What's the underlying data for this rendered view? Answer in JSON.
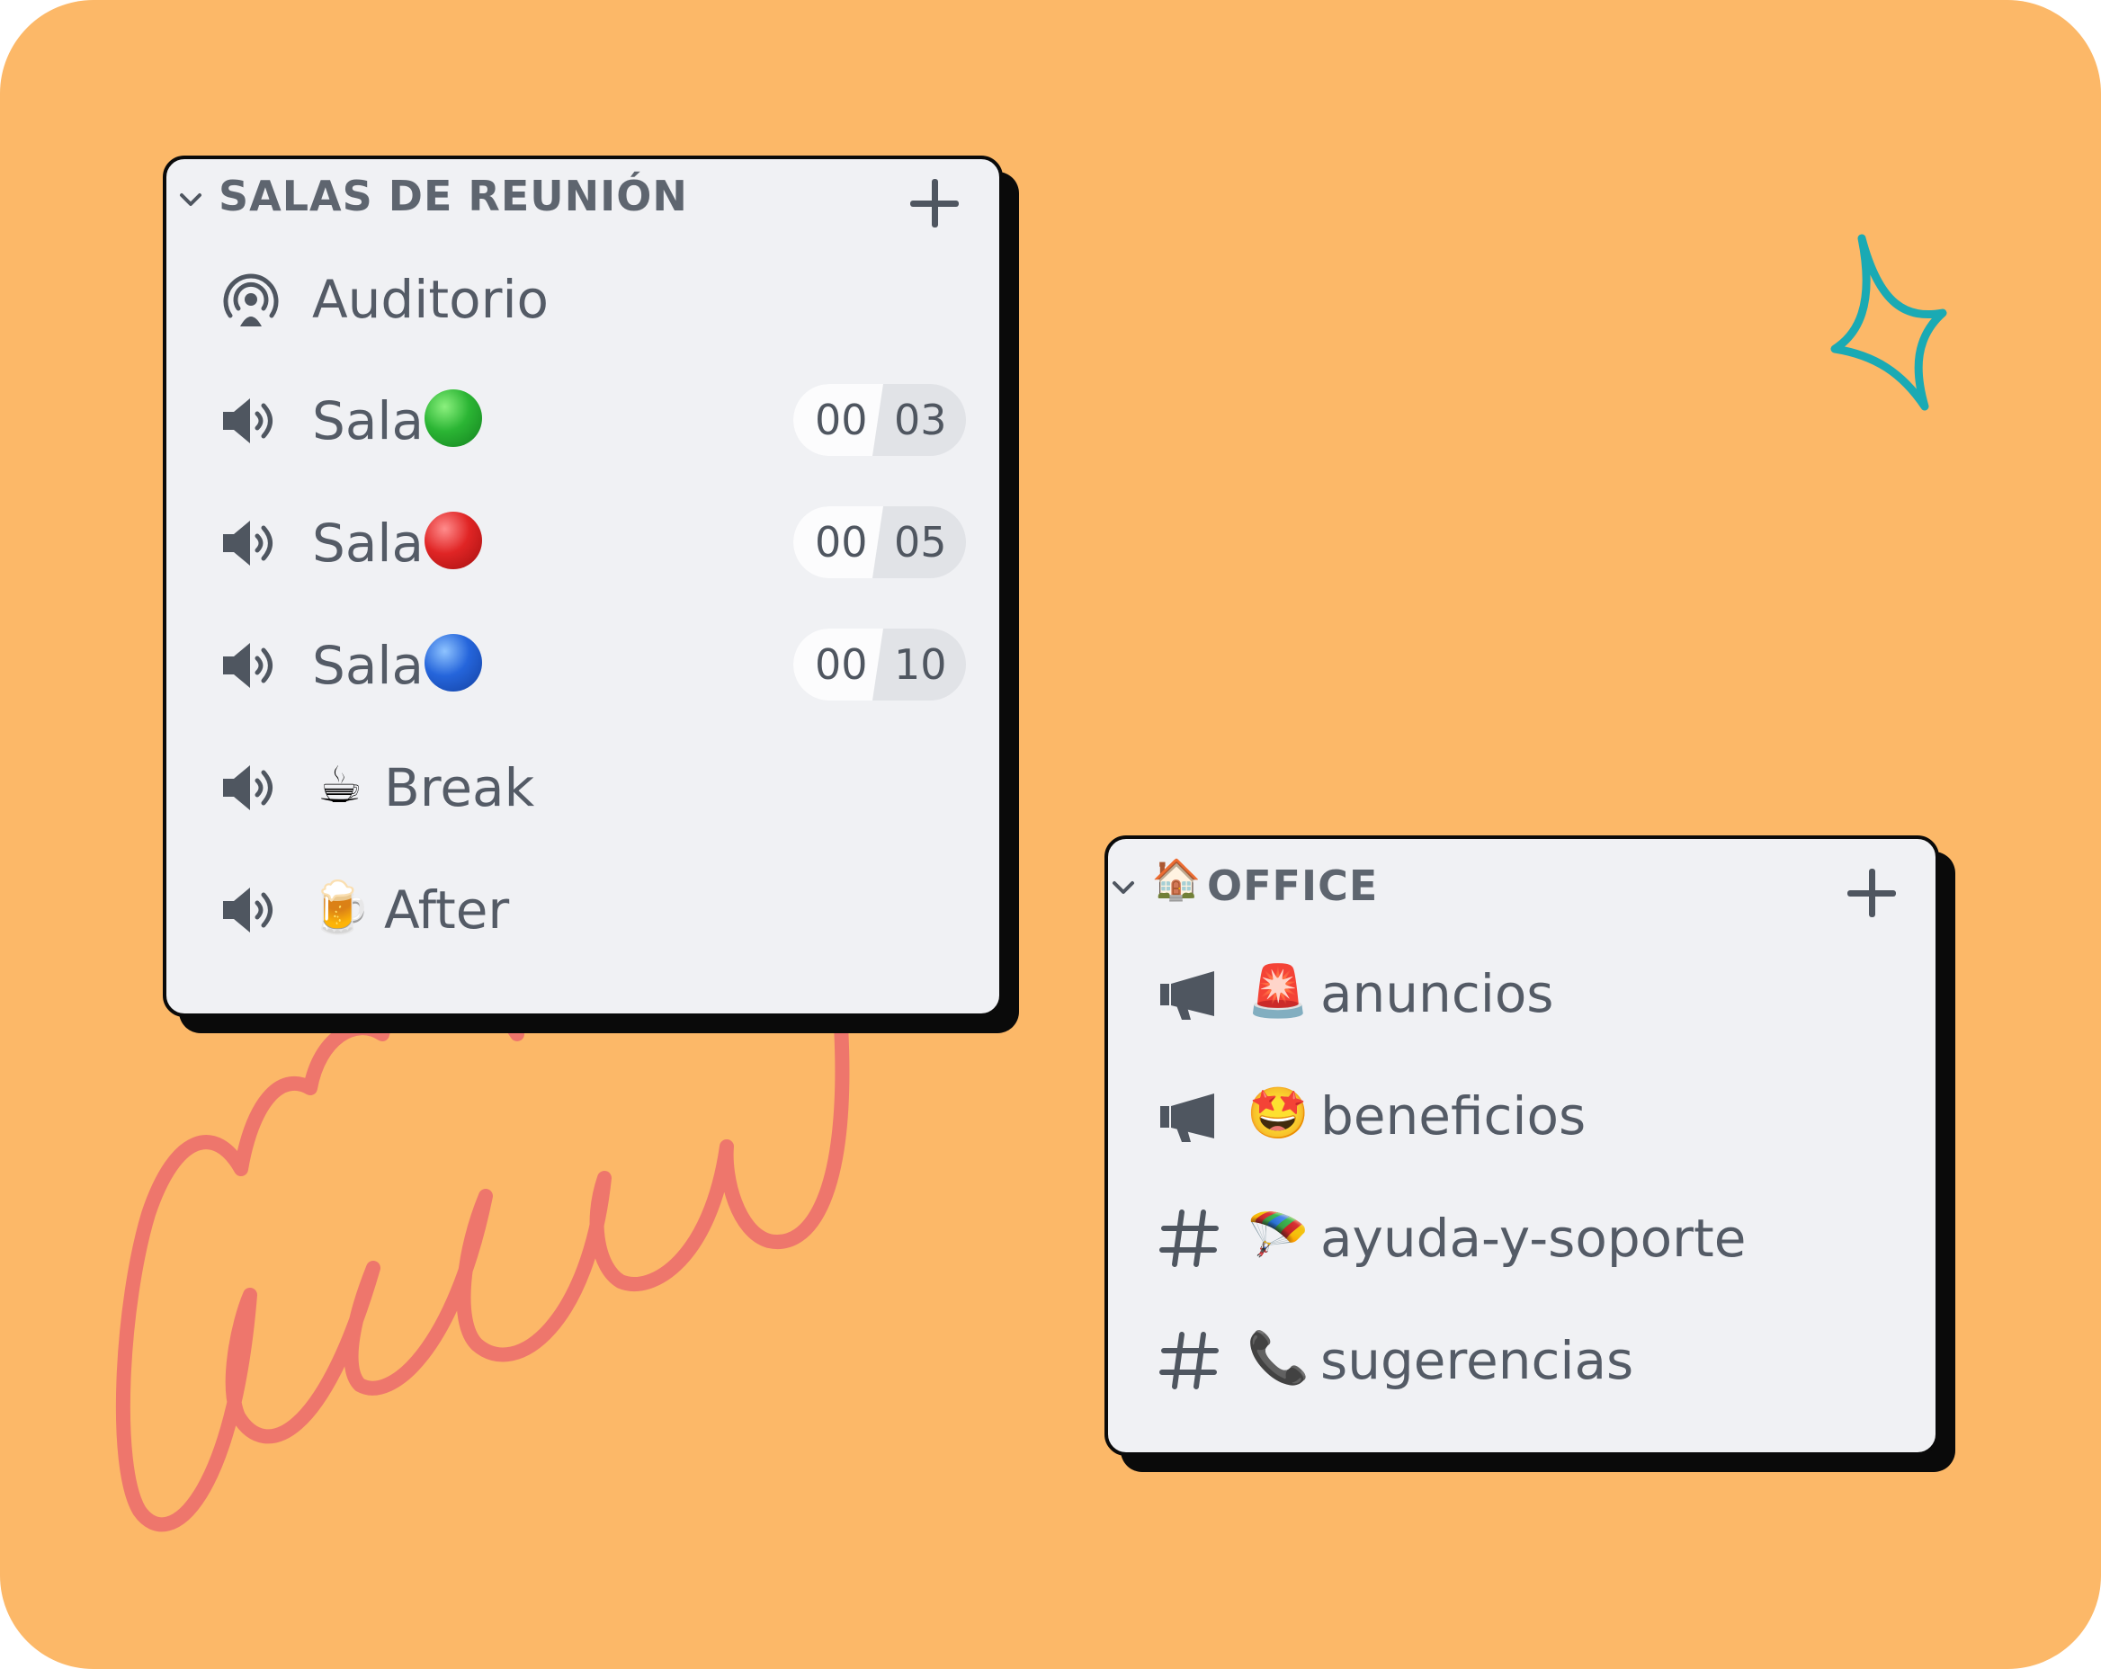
{
  "colors": {
    "background": "#FCB868",
    "panel": "#F0F1F4",
    "text": "#545B66",
    "sparkle": "#1AAAB4",
    "cloud": "#EE766C"
  },
  "salas_panel": {
    "title": "SALAS DE REUNIÓN",
    "collapse_icon": "chevron-down-icon",
    "add_icon": "plus-icon",
    "items": [
      {
        "icon": "stage-icon",
        "label": "Auditorio",
        "emoji": "",
        "status_color": ""
      },
      {
        "icon": "speaker-icon",
        "label": "Sala",
        "status_color": "#2BB534",
        "counter_left": "00",
        "counter_right": "03"
      },
      {
        "icon": "speaker-icon",
        "label": "Sala",
        "status_color": "#E02525",
        "counter_left": "00",
        "counter_right": "05"
      },
      {
        "icon": "speaker-icon",
        "label": "Sala",
        "status_color": "#2565DB",
        "counter_left": "00",
        "counter_right": "10"
      },
      {
        "icon": "speaker-icon",
        "label": "Break",
        "emoji": "☕"
      },
      {
        "icon": "speaker-icon",
        "label": "After",
        "emoji": "🍺"
      }
    ]
  },
  "office_panel": {
    "title_emoji": "🏠",
    "title": "OFFICE",
    "collapse_icon": "chevron-down-icon",
    "add_icon": "plus-icon",
    "items": [
      {
        "icon": "megaphone-icon",
        "emoji": "🚨",
        "label": "anuncios"
      },
      {
        "icon": "megaphone-icon",
        "emoji": "🤩",
        "label": "beneficios"
      },
      {
        "icon": "hashtag-icon",
        "emoji": "🪂",
        "label": "ayuda-y-soporte"
      },
      {
        "icon": "hashtag-icon",
        "emoji": "📞",
        "label": "sugerencias"
      }
    ]
  }
}
